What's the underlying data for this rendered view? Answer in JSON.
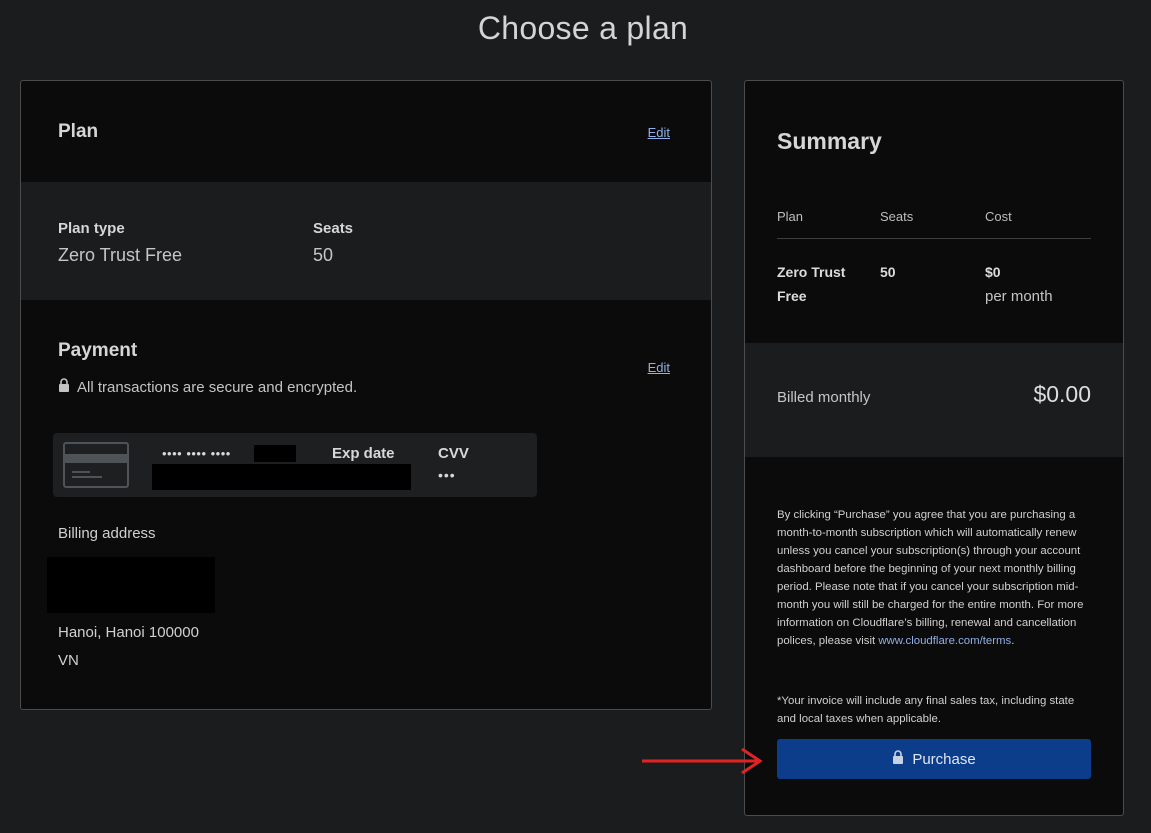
{
  "page": {
    "title": "Choose a plan"
  },
  "plan_section": {
    "title": "Plan",
    "edit_label": "Edit",
    "plan_type_label": "Plan type",
    "plan_type_value": "Zero Trust Free",
    "seats_label": "Seats",
    "seats_value": "50"
  },
  "payment_section": {
    "title": "Payment",
    "edit_label": "Edit",
    "secure_note": "All transactions are secure and encrypted.",
    "card": {
      "masked_number": "•••• •••• ••••",
      "exp_label": "Exp date",
      "cvv_label": "CVV",
      "cvv_value": "•••"
    },
    "billing_address_label": "Billing address",
    "address_city": "Hanoi, Hanoi 100000",
    "address_country": "VN"
  },
  "summary": {
    "title": "Summary",
    "columns": [
      "Plan",
      "Seats",
      "Cost"
    ],
    "row": {
      "plan_line1": "Zero Trust",
      "plan_line2": "Free",
      "seats": "50",
      "cost": "$0",
      "cost_period": "per month"
    },
    "billed_label": "Billed monthly",
    "billed_amount": "$0.00",
    "terms_text": "By clicking “Purchase” you agree that you are purchasing a month-to-month subscription which will automatically renew unless you cancel your subscription(s) through your account dashboard before the beginning of your next monthly billing period. Please note that if you cancel your subscription mid-month you will still be charged for the entire month. For more information on Cloudflare’s billing, renewal and cancellation polices, please visit",
    "terms_link": "www.cloudflare.com/terms",
    "terms_end": ".",
    "tax_note": "*Your invoice will include any final sales tax, including state and local taxes when applicable.",
    "purchase_label": "Purchase"
  },
  "colors": {
    "background": "#1b1c1e",
    "card": "#0b0b0c",
    "link": "#8fb0e8",
    "purchase_button": "#0c3d8a",
    "annotation_arrow": "#e02424"
  }
}
